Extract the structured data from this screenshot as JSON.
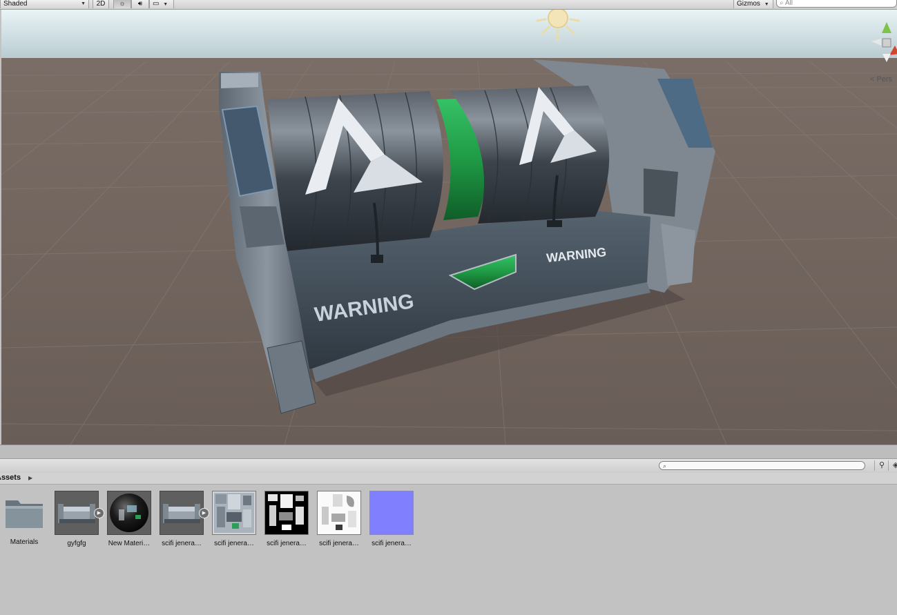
{
  "scene_toolbar": {
    "draw_mode": "Shaded",
    "mode_2d": "2D",
    "gizmos": "Gizmos",
    "search_placeholder": "All",
    "icons": [
      "sun-lighting-icon",
      "audio-icon",
      "image-effects-icon"
    ]
  },
  "viewport": {
    "projection_label": "Pers",
    "model_text_front": "WARNING",
    "model_text_side": "WARNING",
    "colors": {
      "sky": "#d8e8ec",
      "ground": "#6d615b",
      "green_accent": "#1f9a45"
    }
  },
  "project": {
    "breadcrumb": "Assets",
    "assets": [
      {
        "label": "Materials",
        "type": "folder"
      },
      {
        "label": "gyfgfg",
        "type": "model"
      },
      {
        "label": "New Materi…",
        "type": "material"
      },
      {
        "label": "scifi jenera…",
        "type": "model"
      },
      {
        "label": "scifi jenera…",
        "type": "texture-albedo"
      },
      {
        "label": "scifi jenera…",
        "type": "texture-mask"
      },
      {
        "label": "scifi jenera…",
        "type": "texture-ao"
      },
      {
        "label": "scifi jenera…",
        "type": "texture-normal"
      }
    ]
  }
}
